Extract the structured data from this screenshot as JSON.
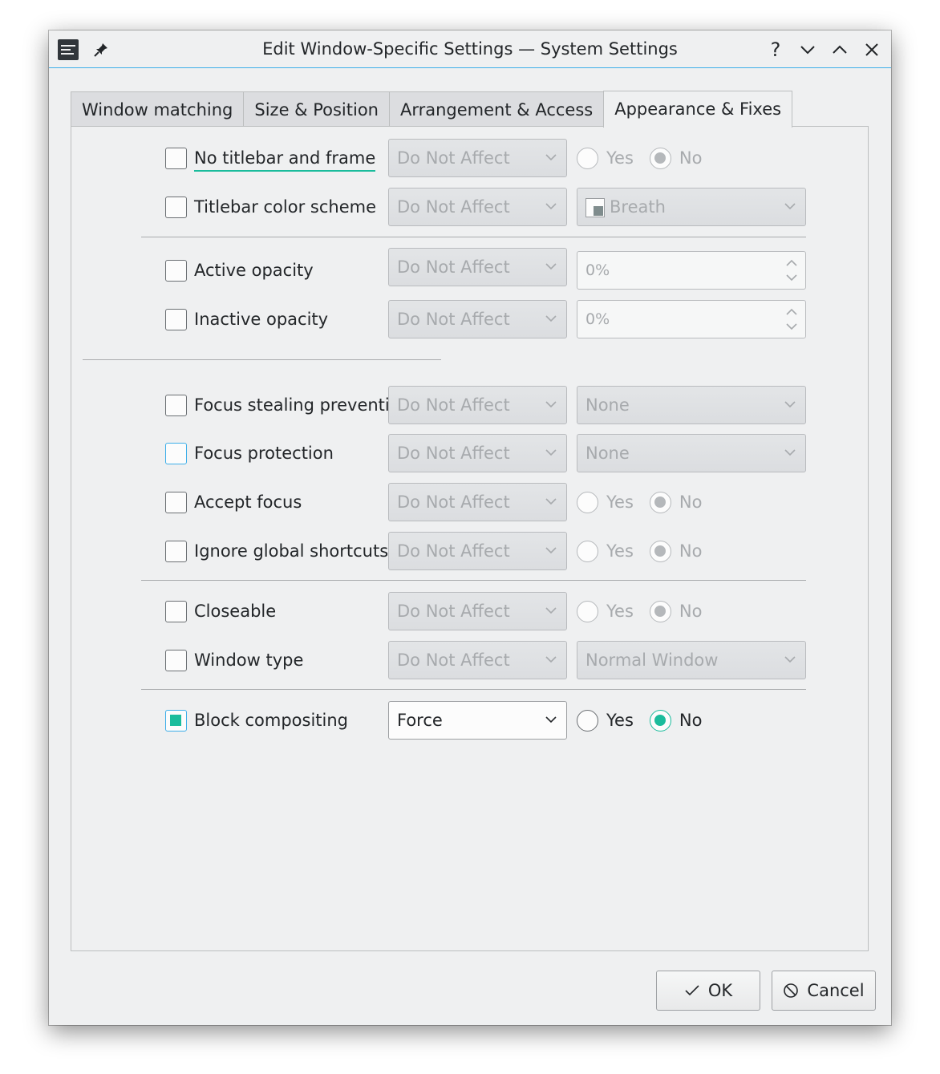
{
  "window": {
    "title": "Edit Window-Specific Settings — System Settings",
    "help_label": "?",
    "accent_color": "#3daee9",
    "check_color": "#1abc9c"
  },
  "tabs": [
    {
      "label": "Window matching",
      "active": false
    },
    {
      "label": "Size & Position",
      "active": false
    },
    {
      "label": "Arrangement & Access",
      "active": false
    },
    {
      "label": "Appearance & Fixes",
      "active": true
    }
  ],
  "rows": {
    "no_titlebar": {
      "label": "No titlebar and frame",
      "checked": false,
      "policy": "Do Not Affect",
      "yes": "Yes",
      "no": "No",
      "selected": "No"
    },
    "titlebar_color": {
      "label": "Titlebar color scheme",
      "checked": false,
      "policy": "Do Not Affect",
      "value": "Breath"
    },
    "active_opacity": {
      "label": "Active opacity",
      "checked": false,
      "policy": "Do Not Affect",
      "value": "0%"
    },
    "inactive_opacity": {
      "label": "Inactive opacity",
      "checked": false,
      "policy": "Do Not Affect",
      "value": "0%"
    },
    "focus_stealing": {
      "label": "Focus stealing prevention",
      "checked": false,
      "policy": "Do Not Affect",
      "value": "None"
    },
    "focus_protection": {
      "label": "Focus protection",
      "checked": false,
      "policy": "Do Not Affect",
      "value": "None"
    },
    "accept_focus": {
      "label": "Accept focus",
      "checked": false,
      "policy": "Do Not Affect",
      "yes": "Yes",
      "no": "No",
      "selected": "No"
    },
    "ignore_shortcuts": {
      "label": "Ignore global shortcuts",
      "checked": false,
      "policy": "Do Not Affect",
      "yes": "Yes",
      "no": "No",
      "selected": "No"
    },
    "closeable": {
      "label": "Closeable",
      "checked": false,
      "policy": "Do Not Affect",
      "yes": "Yes",
      "no": "No",
      "selected": "No"
    },
    "window_type": {
      "label": "Window type",
      "checked": false,
      "policy": "Do Not Affect",
      "value": "Normal Window"
    },
    "block_compositing": {
      "label": "Block compositing",
      "checked": true,
      "policy": "Force",
      "yes": "Yes",
      "no": "No",
      "selected": "No"
    }
  },
  "buttons": {
    "ok": "OK",
    "cancel": "Cancel"
  },
  "icons": {
    "app": "system-settings-icon",
    "pin": "pin-icon",
    "minimize": "chevron-down-icon",
    "maximize": "chevron-up-icon",
    "close": "close-icon",
    "ok": "checkmark-icon",
    "cancel": "cancel-icon"
  }
}
